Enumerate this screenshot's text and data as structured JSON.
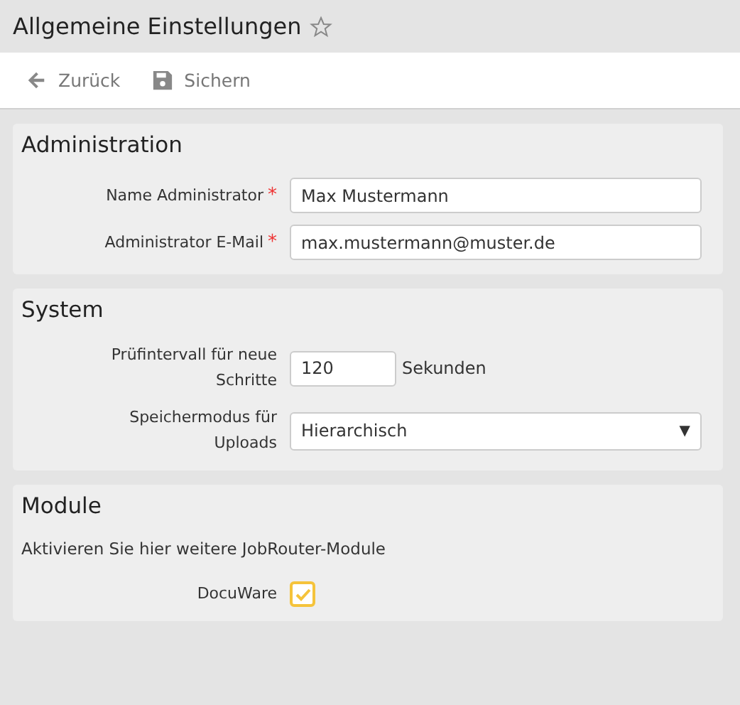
{
  "header": {
    "title": "Allgemeine Einstellungen",
    "favorite": false
  },
  "required_mark": "*",
  "toolbar": [
    {
      "kind": "back",
      "label": "Zurück"
    },
    {
      "kind": "save",
      "label": "Sichern"
    }
  ],
  "sections": [
    {
      "title": "Administration",
      "fields": [
        {
          "kind": "text",
          "label": "Name Administrator",
          "required": true,
          "value": "Max Mustermann"
        },
        {
          "kind": "text",
          "label": "Administrator E-Mail",
          "required": true,
          "value": "max.mustermann@muster.de"
        }
      ]
    },
    {
      "title": "System",
      "fields": [
        {
          "kind": "number",
          "label": "Prüfintervall für neue Schritte",
          "required": false,
          "value": "120",
          "unit": "Sekunden"
        },
        {
          "kind": "select",
          "label": "Speichermodus für Uploads",
          "required": false,
          "value": "Hierarchisch",
          "arrow": "▼"
        }
      ]
    },
    {
      "title": "Module",
      "description": "Aktivieren Sie hier weitere JobRouter-Module",
      "fields": [
        {
          "kind": "checkbox",
          "label": "DocuWare",
          "required": false,
          "checked": true
        }
      ]
    }
  ]
}
